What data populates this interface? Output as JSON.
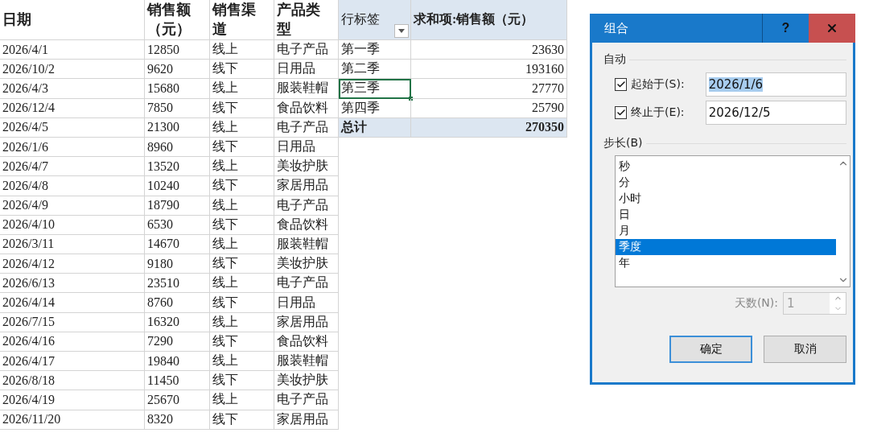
{
  "sheet": {
    "columns": [
      "日期",
      "销售额（元）",
      "销售渠道",
      "产品类型"
    ],
    "rows": [
      [
        "2026/4/1",
        "12850",
        "线上",
        "电子产品"
      ],
      [
        "2026/10/2",
        "9620",
        "线下",
        "日用品"
      ],
      [
        "2026/4/3",
        "15680",
        "线上",
        "服装鞋帽"
      ],
      [
        "2026/12/4",
        "7850",
        "线下",
        "食品饮料"
      ],
      [
        "2026/4/5",
        "21300",
        "线上",
        "电子产品"
      ],
      [
        "2026/1/6",
        "8960",
        "线下",
        "日用品"
      ],
      [
        "2026/4/7",
        "13520",
        "线上",
        "美妆护肤"
      ],
      [
        "2026/4/8",
        "10240",
        "线下",
        "家居用品"
      ],
      [
        "2026/4/9",
        "18790",
        "线上",
        "电子产品"
      ],
      [
        "2026/4/10",
        "6530",
        "线下",
        "食品饮料"
      ],
      [
        "2026/3/11",
        "14670",
        "线上",
        "服装鞋帽"
      ],
      [
        "2026/4/12",
        "9180",
        "线下",
        "美妆护肤"
      ],
      [
        "2026/6/13",
        "23510",
        "线上",
        "电子产品"
      ],
      [
        "2026/4/14",
        "8760",
        "线下",
        "日用品"
      ],
      [
        "2026/7/15",
        "16320",
        "线上",
        "家居用品"
      ],
      [
        "2026/4/16",
        "7290",
        "线下",
        "食品饮料"
      ],
      [
        "2026/4/17",
        "19840",
        "线上",
        "服装鞋帽"
      ],
      [
        "2026/8/18",
        "11450",
        "线下",
        "美妆护肤"
      ],
      [
        "2026/4/19",
        "25670",
        "线上",
        "电子产品"
      ],
      [
        "2026/11/20",
        "8320",
        "线下",
        "家居用品"
      ]
    ]
  },
  "pivot": {
    "row_header": "行标签",
    "value_header": "求和项:销售额（元）",
    "rows": [
      {
        "label": "第一季",
        "value": "23630",
        "selected": false
      },
      {
        "label": "第二季",
        "value": "193160",
        "selected": false
      },
      {
        "label": "第三季",
        "value": "27770",
        "selected": true
      },
      {
        "label": "第四季",
        "value": "25790",
        "selected": false
      }
    ],
    "total": {
      "label": "总计",
      "value": "270350"
    }
  },
  "dialog": {
    "title": "组合",
    "help_button": "?",
    "auto_section": "自动",
    "bounds": [
      {
        "label": "起始于(S):",
        "checked": true,
        "value": "2026/1/6",
        "highlighted": true
      },
      {
        "label": "终止于(E):",
        "checked": true,
        "value": "2026/12/5",
        "highlighted": false
      }
    ],
    "step_section": "步长(B)",
    "steps": [
      {
        "label": "秒",
        "selected": false
      },
      {
        "label": "分",
        "selected": false
      },
      {
        "label": "小时",
        "selected": false
      },
      {
        "label": "日",
        "selected": false
      },
      {
        "label": "月",
        "selected": false
      },
      {
        "label": "季度",
        "selected": true
      },
      {
        "label": "年",
        "selected": false
      }
    ],
    "days": {
      "label": "天数(N):",
      "value": "1",
      "disabled": true
    },
    "buttons": [
      {
        "label": "确定",
        "default": true
      },
      {
        "label": "取消",
        "default": false
      }
    ]
  }
}
